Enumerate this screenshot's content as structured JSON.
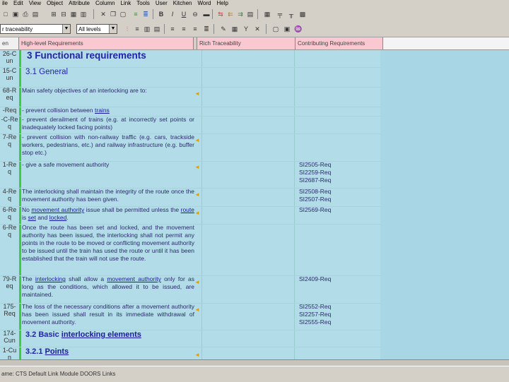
{
  "menu": [
    "ile",
    "Edit",
    "View",
    "Object",
    "Attribute",
    "Column",
    "Link",
    "Tools",
    "User",
    "Kitchen",
    "Word",
    "Help"
  ],
  "toolbar2": {
    "view_combo": "r traceability",
    "level_combo": "All levels"
  },
  "columns": {
    "id": "en",
    "req": "High-level Requirements",
    "rich": "Rich Traceability",
    "contrib": "Contributing Requirements"
  },
  "rows": [
    {
      "id": "26-C\nun",
      "type": "h1",
      "text": "3 Functional requirements",
      "mark": false,
      "contrib": ""
    },
    {
      "id": "15-C\nun",
      "type": "h2",
      "text": "3.1 General",
      "mark": false,
      "contrib": ""
    },
    {
      "id": "68-R\neq",
      "type": "p",
      "text": "Main safety objectives of an interlocking are to:",
      "mark": true,
      "contrib": ""
    },
    {
      "id": "-Req",
      "type": "p",
      "text": "- prevent collision between trains",
      "mark": false,
      "contrib": ""
    },
    {
      "id": "-C-Re\nq",
      "type": "p",
      "text": "- prevent derailment of trains (e.g. at incorrectly set points or inadequately locked facing points)",
      "mark": false,
      "contrib": ""
    },
    {
      "id": "7-Re\nq",
      "type": "p",
      "text": "- prevent collision with non-railway traffic (e.g. cars, trackside workers, pedestrians, etc.) and railway infrastructure (e.g. buffer stop etc.)",
      "mark": true,
      "contrib": ""
    },
    {
      "id": "1-Re\nq",
      "type": "p",
      "text": "- give a safe movement authority",
      "mark": true,
      "contrib": "SI2505-Req\nSI2259-Req\nSI2687-Req"
    },
    {
      "id": "4-Re\nq",
      "type": "p",
      "text": "The interlocking shall maintain the integrity of the route once the movement authority has been given.",
      "mark": true,
      "contrib": "SI2508-Req\nSI2507-Req"
    },
    {
      "id": "6-Re\nq",
      "type": "p",
      "text": "No movement authority issue shall be permitted unless the route is set and locked.",
      "mark": true,
      "contrib": "SI2569-Req"
    },
    {
      "id": "6-Re\nq",
      "type": "p",
      "text": "Once the route has been set and locked, and the movement authority has been issued, the interlocking shall not permit any points in the route to be moved or conflicting movement authority to be issued until the train has used the route or until it has been established that the train will not use the route.",
      "mark": false,
      "contrib": ""
    },
    {
      "id": "79-R\neq",
      "type": "p",
      "text": "The interlocking shall allow a movement authority only for as long as the conditions, which allowed it to be issued, are maintained.",
      "mark": true,
      "contrib": "SI2409-Req"
    },
    {
      "id": "175-\nReq",
      "type": "p",
      "text": "The loss of the necessary conditions after a movement authority has been issued shall result in its immediate withdrawal of movement authority.",
      "mark": true,
      "contrib": "SI2552-Req\nSI2257-Req\nSI2555-Req"
    },
    {
      "id": "174-\nCun",
      "type": "h3",
      "text": "3.2 Basic interlocking elements",
      "mark": false,
      "contrib": ""
    },
    {
      "id": "1-Cu\nn",
      "type": "h3",
      "text": "3.2.1 Points",
      "mark": true,
      "contrib": ""
    }
  ],
  "status": "ame: CTS Default Link Module DOORS Links",
  "colors": {
    "grid_bg": "#b3dce9",
    "header_bg": "#f9c8d0",
    "green_bar": "#3ccc3c",
    "heading": "#2222aa"
  }
}
